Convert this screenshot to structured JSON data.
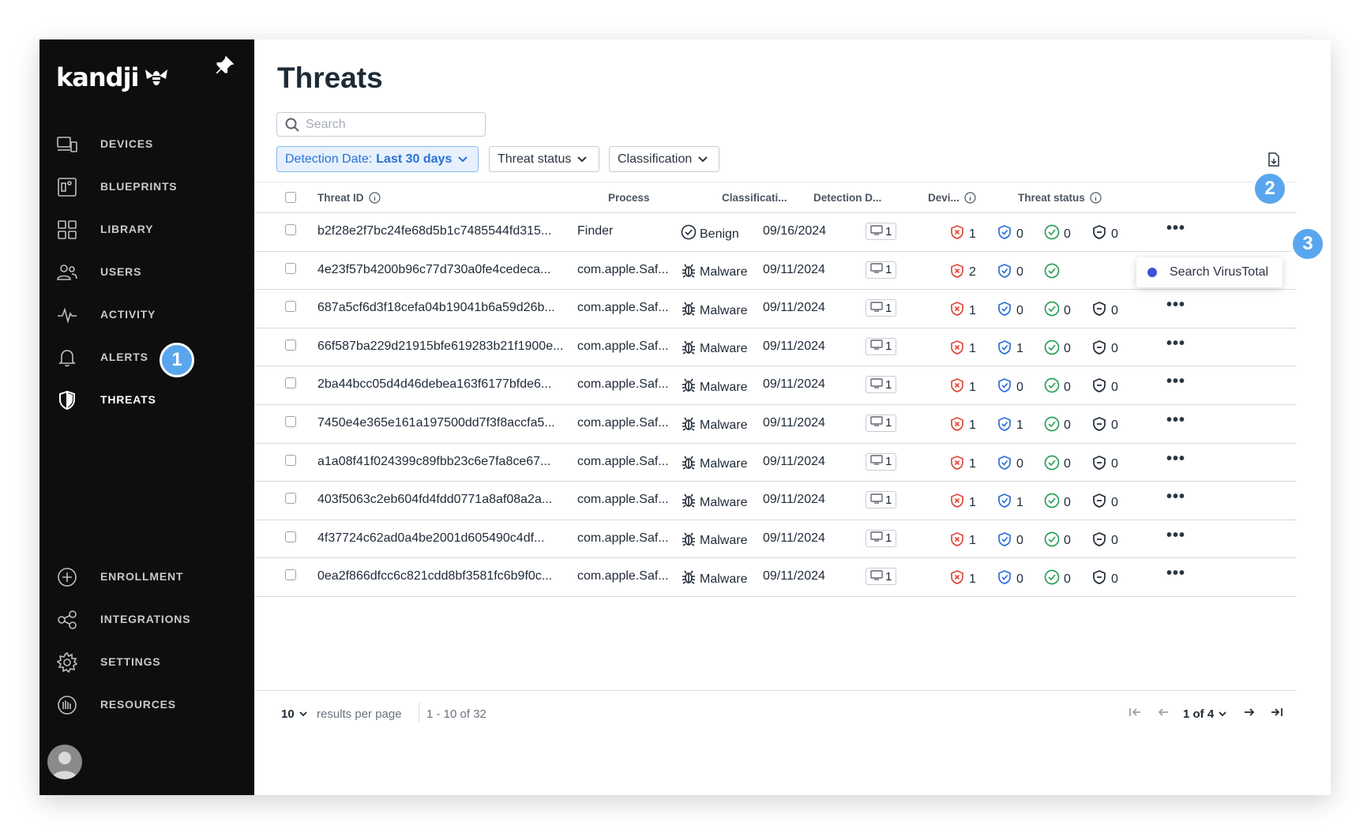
{
  "brand": {
    "name": "kandji"
  },
  "sidebar": {
    "items": [
      {
        "id": "devices",
        "label": "DEVICES",
        "icon": "devices-icon"
      },
      {
        "id": "blueprints",
        "label": "BLUEPRINTS",
        "icon": "blueprint-icon"
      },
      {
        "id": "library",
        "label": "LIBRARY",
        "icon": "library-icon"
      },
      {
        "id": "users",
        "label": "USERS",
        "icon": "users-icon"
      },
      {
        "id": "activity",
        "label": "ACTIVITY",
        "icon": "activity-icon"
      },
      {
        "id": "alerts",
        "label": "ALERTS",
        "icon": "bell-icon"
      },
      {
        "id": "threats",
        "label": "THREATS",
        "icon": "shield-icon",
        "active": true
      }
    ],
    "bottom_items": [
      {
        "id": "enrollment",
        "label": "ENROLLMENT",
        "icon": "plus-circle-icon"
      },
      {
        "id": "integrations",
        "label": "INTEGRATIONS",
        "icon": "integrations-icon"
      },
      {
        "id": "settings",
        "label": "SETTINGS",
        "icon": "gear-icon"
      },
      {
        "id": "resources",
        "label": "RESOURCES",
        "icon": "resources-icon"
      }
    ]
  },
  "callouts": {
    "one": "1",
    "two": "2",
    "three": "3"
  },
  "page": {
    "title": "Threats"
  },
  "search": {
    "placeholder": "Search"
  },
  "filters": {
    "detection_date_label": "Detection Date:",
    "detection_date_value": "Last 30 days",
    "threat_status": "Threat status",
    "classification": "Classification"
  },
  "table": {
    "headers": {
      "threat_id": "Threat ID",
      "process": "Process",
      "classification": "Classificati...",
      "detection_date": "Detection D...",
      "devices": "Devi...",
      "threat_status": "Threat status"
    },
    "rows": [
      {
        "threat_id": "b2f28e2f7bc24fe68d5b1c7485544fd315...",
        "process": "Finder",
        "classification": "Benign",
        "date": "09/16/2024",
        "devices": "1",
        "malicious": "1",
        "protected": "0",
        "resolved": "0",
        "other": "0"
      },
      {
        "threat_id": "4e23f57b4200b96c77d730a0fe4cedeca...",
        "process": "com.apple.Saf...",
        "classification": "Malware",
        "date": "09/11/2024",
        "devices": "1",
        "malicious": "2",
        "protected": "0",
        "resolved": "",
        "other": ""
      },
      {
        "threat_id": "687a5cf6d3f18cefa04b19041b6a59d26b...",
        "process": "com.apple.Saf...",
        "classification": "Malware",
        "date": "09/11/2024",
        "devices": "1",
        "malicious": "1",
        "protected": "0",
        "resolved": "0",
        "other": "0"
      },
      {
        "threat_id": "66f587ba229d21915bfe619283b21f1900e...",
        "process": "com.apple.Saf...",
        "classification": "Malware",
        "date": "09/11/2024",
        "devices": "1",
        "malicious": "1",
        "protected": "1",
        "resolved": "0",
        "other": "0"
      },
      {
        "threat_id": "2ba44bcc05d4d46debea163f6177bfde6...",
        "process": "com.apple.Saf...",
        "classification": "Malware",
        "date": "09/11/2024",
        "devices": "1",
        "malicious": "1",
        "protected": "0",
        "resolved": "0",
        "other": "0"
      },
      {
        "threat_id": "7450e4e365e161a197500dd7f3f8accfa5...",
        "process": "com.apple.Saf...",
        "classification": "Malware",
        "date": "09/11/2024",
        "devices": "1",
        "malicious": "1",
        "protected": "1",
        "resolved": "0",
        "other": "0"
      },
      {
        "threat_id": "a1a08f41f024399c89fbb23c6e7fa8ce67...",
        "process": "com.apple.Saf...",
        "classification": "Malware",
        "date": "09/11/2024",
        "devices": "1",
        "malicious": "1",
        "protected": "0",
        "resolved": "0",
        "other": "0"
      },
      {
        "threat_id": "403f5063c2eb604fd4fdd0771a8af08a2a...",
        "process": "com.apple.Saf...",
        "classification": "Malware",
        "date": "09/11/2024",
        "devices": "1",
        "malicious": "1",
        "protected": "1",
        "resolved": "0",
        "other": "0"
      },
      {
        "threat_id": "4f37724c62ad0a4be2001d605490c4df...",
        "process": "com.apple.Saf...",
        "classification": "Malware",
        "date": "09/11/2024",
        "devices": "1",
        "malicious": "1",
        "protected": "0",
        "resolved": "0",
        "other": "0"
      },
      {
        "threat_id": "0ea2f866dfcc6c821cdd8bf3581fc6b9f0c...",
        "process": "com.apple.Saf...",
        "classification": "Malware",
        "date": "09/11/2024",
        "devices": "1",
        "malicious": "1",
        "protected": "0",
        "resolved": "0",
        "other": "0"
      }
    ]
  },
  "popover": {
    "label": "Search VirusTotal"
  },
  "footer": {
    "per_page": "10",
    "per_page_label": "results per page",
    "range": "1 - 10 of 32",
    "page": "1 of 4"
  },
  "colors": {
    "accent": "#2a72d5",
    "malicious": "#e04a3a",
    "protected": "#2f6fd6",
    "resolved": "#2fa05a",
    "badge": "#5aa6ee"
  }
}
